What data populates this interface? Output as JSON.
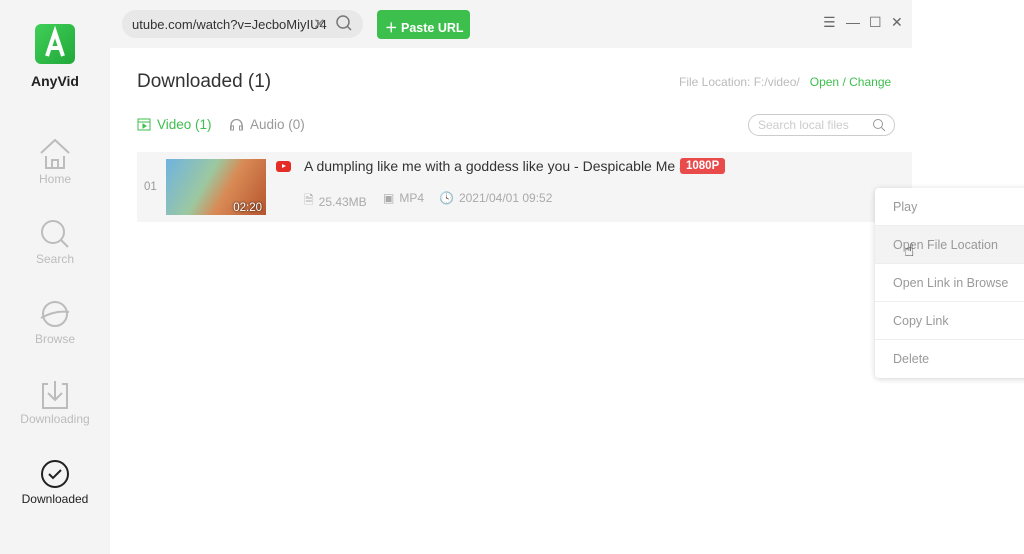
{
  "app": {
    "name": "AnyVid",
    "brand_color": "#3dbf4d"
  },
  "sidebar": {
    "items": [
      {
        "label": "Home",
        "icon": "home-icon"
      },
      {
        "label": "Search",
        "icon": "search-icon"
      },
      {
        "label": "Browse",
        "icon": "planet-icon"
      },
      {
        "label": "Downloading",
        "icon": "download-icon"
      },
      {
        "label": "Downloaded",
        "icon": "check-circle-icon",
        "active": true
      }
    ]
  },
  "topbar": {
    "url_value": "utube.com/watch?v=JecboMiyIU4",
    "paste_label": "Paste URL"
  },
  "main": {
    "title": "Downloaded (1)",
    "file_location": "File Location: F:/video/",
    "open": "Open",
    "sep": "/",
    "change": "Change",
    "tabs": [
      {
        "label": "Video (1)",
        "active": true
      },
      {
        "label": "Audio (0)"
      }
    ],
    "search_placeholder": "Search local files",
    "items": [
      {
        "index": "01",
        "duration": "02:20",
        "title": "A dumpling like me with a goddess like you - Despicable Me 3",
        "quality": "1080P",
        "size": "25.43MB",
        "format": "MP4",
        "date": "2021/04/01 09:52"
      }
    ]
  },
  "context_menu": {
    "items": [
      "Play",
      "Open File Location",
      "Open Link in Browse",
      "Copy Link",
      "Delete"
    ],
    "hovered": "Open File Location"
  }
}
